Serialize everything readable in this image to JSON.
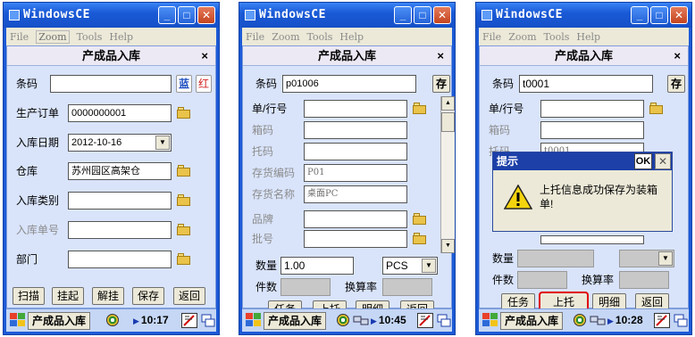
{
  "window_title": "WindowsCE",
  "menu": [
    "File",
    "Zoom",
    "Tools",
    "Help"
  ],
  "form_title": "产成品入库",
  "close_glyph": "×",
  "colors": {
    "titlebar": "#1c5ad6",
    "panel": "#d9e4fb",
    "highlight": "#e10000",
    "blue_text": "#1d4fc0",
    "red_text": "#d22020"
  },
  "screen1": {
    "labels": {
      "barcode": "条码",
      "prod_order": "生产订单",
      "in_date": "入库日期",
      "warehouse": "仓库",
      "in_type": "入库类别",
      "in_no": "入库单号",
      "dept": "部门"
    },
    "values": {
      "barcode": "",
      "prod_order": "0000000001",
      "in_date": "2012-10-16",
      "warehouse": "苏州园区高架仓",
      "in_type": "",
      "in_no": "",
      "dept": ""
    },
    "blue_btn": "蓝",
    "red_btn": "红",
    "buttons": [
      "扫描",
      "挂起",
      "解挂",
      "保存",
      "返回"
    ],
    "time": "10:17"
  },
  "screen2": {
    "labels": {
      "barcode": "条码",
      "line": "单/行号",
      "box": "箱码",
      "pallet": "托码",
      "inv_code": "存货编码",
      "inv_name": "存货名称",
      "brand": "品牌",
      "batch": "批号",
      "qty": "数量",
      "pieces": "件数",
      "rate": "换算率"
    },
    "values": {
      "barcode": "p01006",
      "line": "",
      "box": "",
      "pallet": "",
      "inv_code": "P01",
      "inv_name": "桌面PC",
      "brand": "",
      "batch": "",
      "qty": "1.00",
      "unit": "PCS",
      "pieces": "",
      "rate": ""
    },
    "save_btn": "存",
    "buttons": [
      "任务",
      "上托",
      "明细",
      "返回"
    ],
    "time": "10:45"
  },
  "screen3": {
    "labels": {
      "barcode": "条码",
      "line": "单/行号",
      "box": "箱码",
      "pallet": "托码",
      "qty": "数量",
      "pieces": "件数",
      "rate": "换算率"
    },
    "values": {
      "barcode": "t0001",
      "line": "",
      "box": "",
      "pallet": "t0001",
      "qty": "",
      "pieces": "",
      "rate": ""
    },
    "save_btn": "存",
    "buttons": [
      "任务",
      "上托",
      "明细",
      "返回"
    ],
    "highlighted_button": "上托",
    "dialog": {
      "title": "提示",
      "ok": "OK",
      "message": "上托信息成功保存为装箱单!"
    },
    "time": "10:28"
  },
  "taskbar_app": "产成品入库"
}
